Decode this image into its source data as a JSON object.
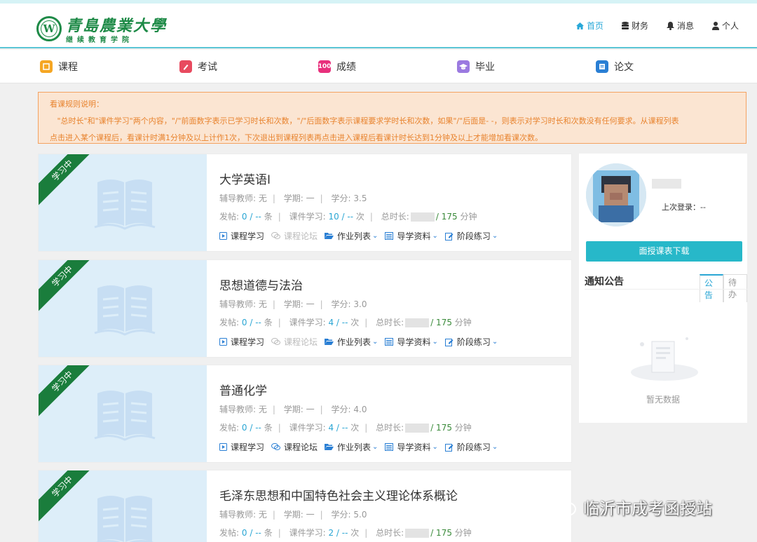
{
  "header": {
    "logo_main": "青島農業大學",
    "logo_sub": "继续教育学院",
    "logo_seal": "W",
    "nav": [
      {
        "label": "首页",
        "icon": "home-icon",
        "active": true
      },
      {
        "label": "财务",
        "icon": "database-icon"
      },
      {
        "label": "消息",
        "icon": "bell-icon"
      },
      {
        "label": "个人",
        "icon": "user-icon"
      }
    ]
  },
  "menu": [
    {
      "label": "课程",
      "icon": "course-icon",
      "color": "#f5a623"
    },
    {
      "label": "考试",
      "icon": "exam-icon",
      "color": "#e84a5f"
    },
    {
      "label": "成绩",
      "icon": "score-icon",
      "color": "#e8307c"
    },
    {
      "label": "毕业",
      "icon": "graduation-icon",
      "color": "#9b7ae0"
    },
    {
      "label": "论文",
      "icon": "paper-icon",
      "color": "#2a7fd4"
    }
  ],
  "notice": {
    "title": "看课规则说明：",
    "line1": "   \"总时长\"和\"课件学习\"两个内容，\"/\"前面数字表示已学习时长和次数，\"/\"后面数字表示课程要求学时长和次数，如果\"/\"后面是- -，则表示对学习时长和次数没有任何要求。从课程列表",
    "line2": "点击进入某个课程后，看课计时满1分钟及以上计作1次，下次退出到课程列表再点击进入课程后看课计时长达到1分钟及以上才能增加看课次数。"
  },
  "labels": {
    "tutor": "辅导教师:",
    "term": "学期:",
    "credit": "学分:",
    "posts": "发帖:",
    "posts_unit": "条",
    "courseware": "课件学习:",
    "times_unit": "次",
    "total": "总时长:",
    "minutes_unit": "分钟"
  },
  "courses": [
    {
      "status": "学习中",
      "title": "大学英语Ⅰ",
      "tutor": "无",
      "term": "一",
      "credit": "3.5",
      "posts_done": "0",
      "posts_req": "--",
      "cw_done": "10",
      "cw_req": "--",
      "time_req": "/ 175",
      "forum_disabled": true
    },
    {
      "status": "学习中",
      "title": "思想道德与法治",
      "tutor": "无",
      "term": "一",
      "credit": "3.0",
      "posts_done": "0",
      "posts_req": "--",
      "cw_done": "4",
      "cw_req": "--",
      "time_req": "/ 175",
      "forum_disabled": true
    },
    {
      "status": "学习中",
      "title": "普通化学",
      "tutor": "无",
      "term": "一",
      "credit": "4.0",
      "posts_done": "0",
      "posts_req": "--",
      "cw_done": "4",
      "cw_req": "--",
      "time_req": "/ 175",
      "forum_disabled": false
    },
    {
      "status": "学习中",
      "title": "毛泽东思想和中国特色社会主义理论体系概论",
      "tutor": "无",
      "term": "一",
      "credit": "5.0",
      "posts_done": "0",
      "posts_req": "--",
      "cw_done": "2",
      "cw_req": "--",
      "time_req": "/ 175",
      "forum_disabled": false
    }
  ],
  "actions": {
    "study": "课程学习",
    "forum": "课程论坛",
    "homework": "作业列表",
    "guide": "导学资料",
    "practice": "阶段练习"
  },
  "profile": {
    "last_login": "上次登录：--",
    "download_button": "面授课表下载",
    "board_title": "通知公告",
    "tabs": [
      "公告",
      "待办"
    ],
    "empty": "暂无数据"
  },
  "watermark": "临沂市成考函授站"
}
